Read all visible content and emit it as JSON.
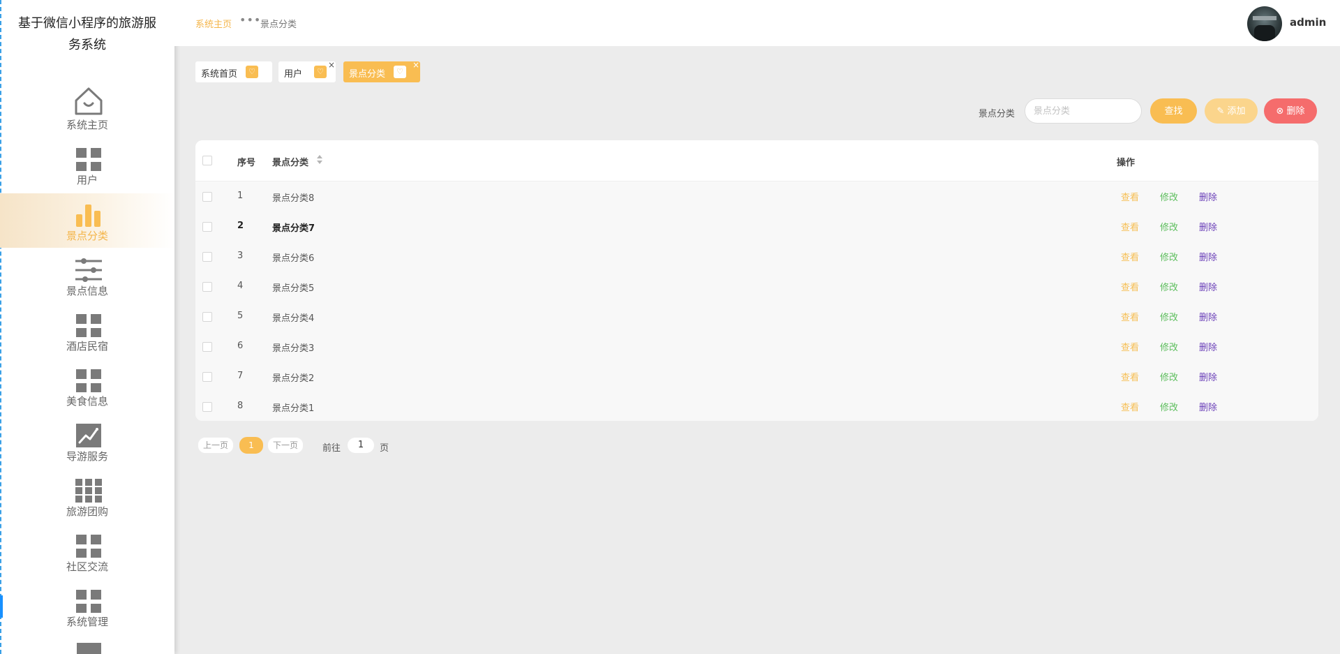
{
  "app": {
    "title": "基于微信小程序的旅游服务系统"
  },
  "sidebar": {
    "items": [
      {
        "label": "系统主页",
        "icon": "home-icon",
        "active": false
      },
      {
        "label": "用户",
        "icon": "grid-icon",
        "active": false
      },
      {
        "label": "景点分类",
        "icon": "bar-chart-icon",
        "active": true
      },
      {
        "label": "景点信息",
        "icon": "sliders-icon",
        "active": false
      },
      {
        "label": "酒店民宿",
        "icon": "grid-icon",
        "active": false
      },
      {
        "label": "美食信息",
        "icon": "grid-icon",
        "active": false
      },
      {
        "label": "导游服务",
        "icon": "trend-chart-icon",
        "active": false
      },
      {
        "label": "旅游团购",
        "icon": "grid-nine-icon",
        "active": false
      },
      {
        "label": "社区交流",
        "icon": "grid-icon",
        "active": false
      },
      {
        "label": "系统管理",
        "icon": "grid-icon",
        "active": false
      }
    ]
  },
  "breadcrumb": {
    "home": "系统主页",
    "separator": "•••",
    "current": "景点分类"
  },
  "user": {
    "name": "admin"
  },
  "tags": [
    {
      "label": "系统首页",
      "closable": false,
      "active": false
    },
    {
      "label": "用户",
      "closable": true,
      "active": false
    },
    {
      "label": "景点分类",
      "closable": true,
      "active": true
    }
  ],
  "tag_icons": {
    "heart": "♡",
    "close": "×"
  },
  "search": {
    "label": "景点分类",
    "placeholder": "景点分类",
    "search_button": "查找",
    "add_button": "添加",
    "add_icon": "✎",
    "delete_button": "删除",
    "delete_icon": "⊗"
  },
  "table": {
    "headers": {
      "index": "序号",
      "category": "景点分类",
      "actions": "操作"
    },
    "rows": [
      {
        "index": "1",
        "category": "景点分类8"
      },
      {
        "index": "2",
        "category": "景点分类7"
      },
      {
        "index": "3",
        "category": "景点分类6"
      },
      {
        "index": "4",
        "category": "景点分类5"
      },
      {
        "index": "5",
        "category": "景点分类4"
      },
      {
        "index": "6",
        "category": "景点分类3"
      },
      {
        "index": "7",
        "category": "景点分类2"
      },
      {
        "index": "8",
        "category": "景点分类1"
      }
    ],
    "actions": {
      "view": "查看",
      "edit": "修改",
      "delete": "删除"
    }
  },
  "pagination": {
    "prev": "上一页",
    "current_page": "1",
    "next": "下一页",
    "goto_label": "前往",
    "goto_value": "1",
    "goto_unit": "页"
  },
  "colors": {
    "accent": "#f9bd52",
    "danger": "#f56c6c",
    "edit": "#5dbe5d",
    "delete_link": "#6a3fb8"
  }
}
